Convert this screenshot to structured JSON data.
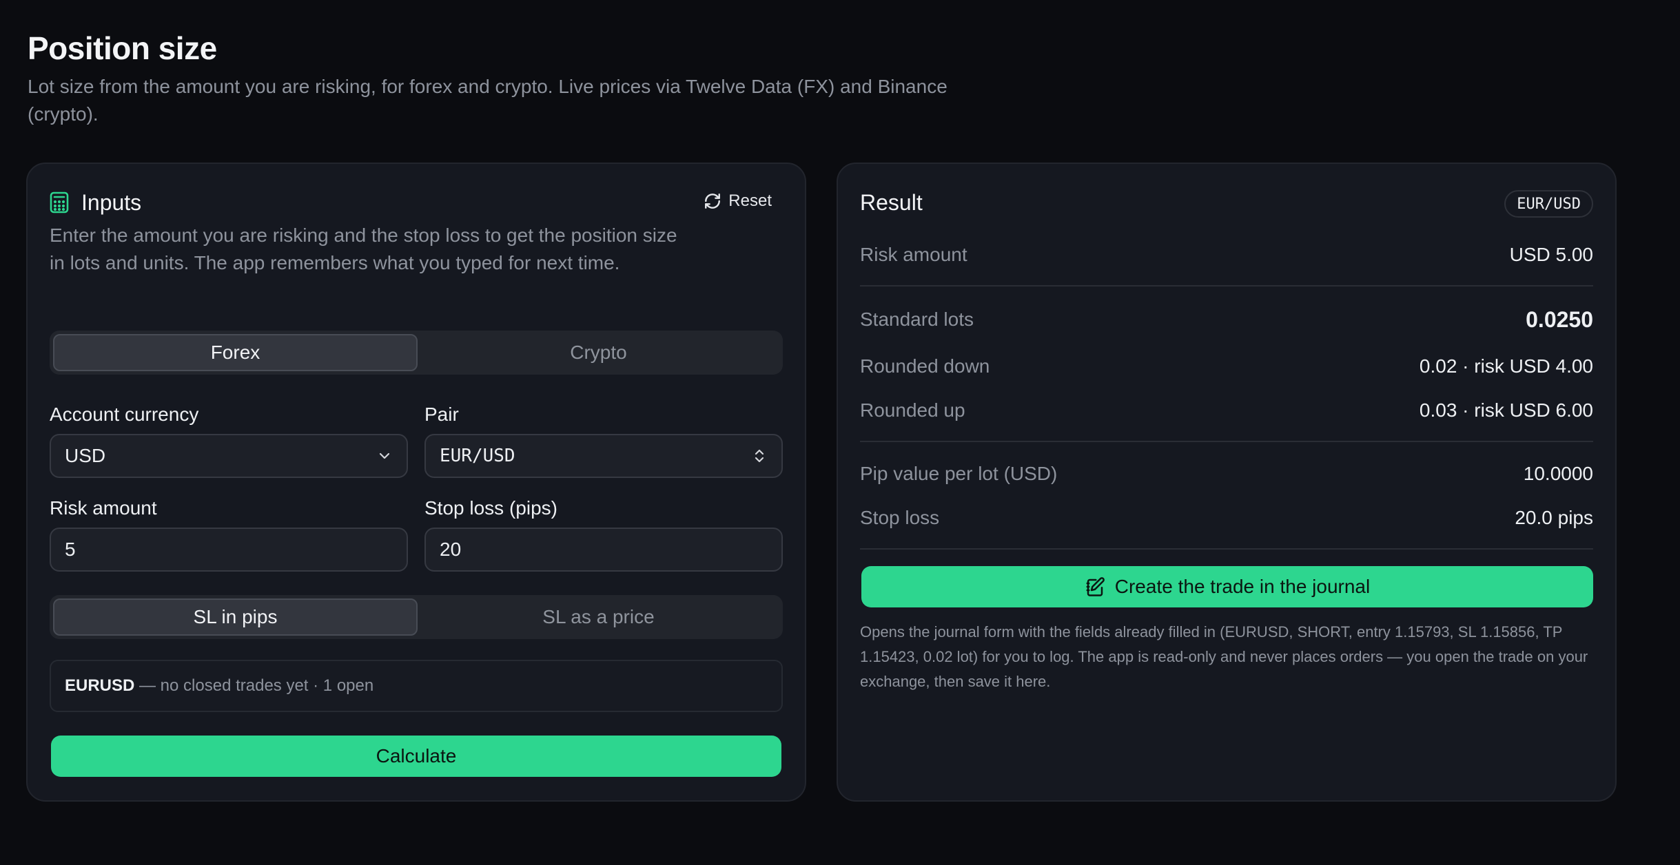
{
  "header": {
    "title": "Position size",
    "subtitle": "Lot size from the amount you are risking, for forex and crypto. Live prices via Twelve Data (FX) and Binance (crypto)."
  },
  "inputs": {
    "title": "Inputs",
    "icon": "calculator-icon",
    "reset_label": "Reset",
    "description": "Enter the amount you are risking and the stop loss to get the position size in lots and units. The app remembers what you typed for next time.",
    "market_tabs": [
      {
        "label": "Forex",
        "active": true
      },
      {
        "label": "Crypto",
        "active": false
      }
    ],
    "account_currency": {
      "label": "Account currency",
      "value": "USD"
    },
    "pair": {
      "label": "Pair",
      "value": "EUR/USD"
    },
    "risk_amount": {
      "label": "Risk amount",
      "value": "5"
    },
    "stop_loss": {
      "label": "Stop loss (pips)",
      "value": "20"
    },
    "sl_mode_tabs": [
      {
        "label": "SL in pips",
        "active": true
      },
      {
        "label": "SL as a price",
        "active": false
      }
    ],
    "info": {
      "symbol": "EURUSD",
      "text": " — no closed trades yet · 1 open"
    },
    "calculate_label": "Calculate"
  },
  "result": {
    "title": "Result",
    "pair_badge": "EUR/USD",
    "rows": {
      "risk_amount": {
        "label": "Risk amount",
        "value": "USD 5.00"
      },
      "standard_lots": {
        "label": "Standard lots",
        "value": "0.0250"
      },
      "rounded_down": {
        "label": "Rounded down",
        "value": "0.02 · risk USD 4.00"
      },
      "rounded_up": {
        "label": "Rounded up",
        "value": "0.03 · risk USD 6.00"
      },
      "pip_value": {
        "label": "Pip value per lot (USD)",
        "value": "10.0000"
      },
      "stop_loss": {
        "label": "Stop loss",
        "value": "20.0 pips"
      }
    },
    "journal_button": "Create the trade in the journal",
    "note": "Opens the journal form with the fields already filled in (EURUSD, SHORT, entry 1.15793, SL 1.15856, TP 1.15423, 0.02 lot) for you to log. The app is read-only and never places orders — you open the trade on your exchange, then save it here."
  },
  "colors": {
    "background": "#0b0c10",
    "card": "#151820",
    "accent": "#2dd68f",
    "muted_text": "#8e939d"
  }
}
